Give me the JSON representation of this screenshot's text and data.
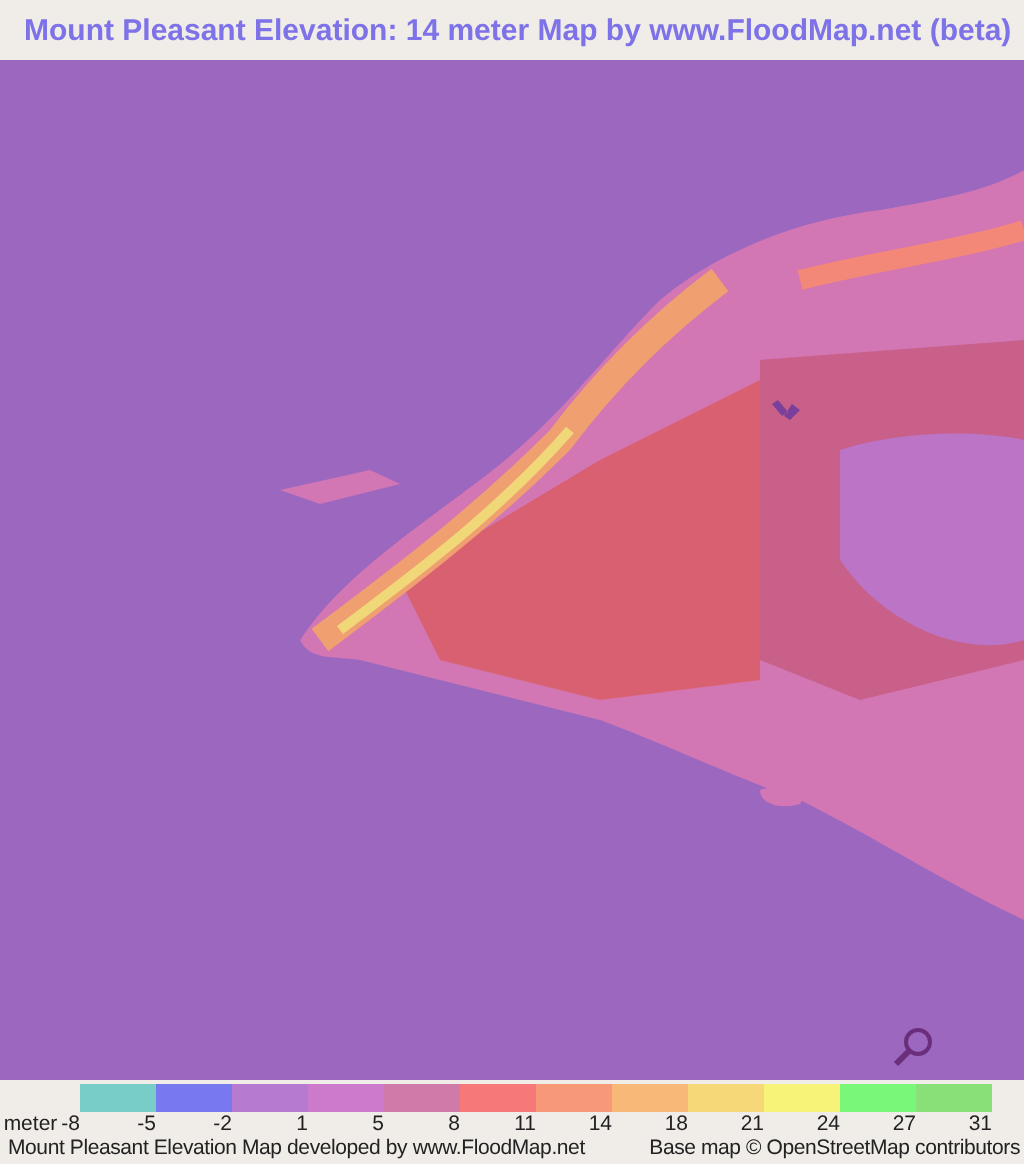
{
  "title": "Mount Pleasant Elevation: 14 meter Map by www.FloodMap.net (beta)",
  "legend": {
    "unit": "meter",
    "swatches": [
      {
        "color": "#78cdc9"
      },
      {
        "color": "#7878f0"
      },
      {
        "color": "#b67ad0"
      },
      {
        "color": "#cd7acc"
      },
      {
        "color": "#d07aaa"
      },
      {
        "color": "#f77878"
      },
      {
        "color": "#f79878"
      },
      {
        "color": "#f7b878"
      },
      {
        "color": "#f7d878"
      },
      {
        "color": "#f7f278"
      },
      {
        "color": "#78f778"
      },
      {
        "color": "#8ae078"
      }
    ],
    "labels": [
      "-8",
      "-5",
      "-2",
      "1",
      "5",
      "8",
      "11",
      "14",
      "18",
      "21",
      "24",
      "27",
      "31"
    ]
  },
  "footer": {
    "credit": "Mount Pleasant Elevation Map developed by www.FloodMap.net",
    "attribution": "Base map © OpenStreetMap contributors"
  }
}
